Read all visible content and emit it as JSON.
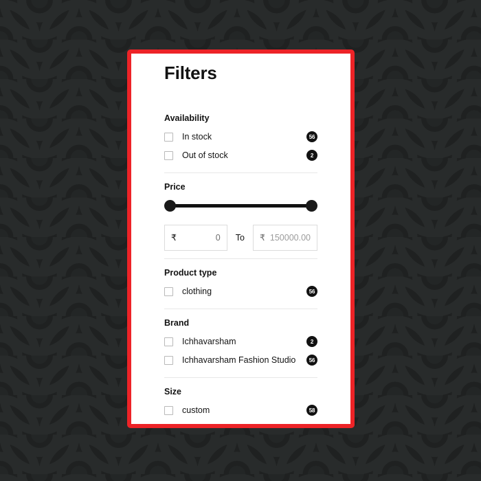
{
  "background": {
    "pattern_name": "seigaiha-wave-pattern",
    "base_color": "#1f2121",
    "arc_color": "#272a2a"
  },
  "panel": {
    "border_color": "#ed2327",
    "background_color": "#ffffff",
    "title": "Filters"
  },
  "sections": [
    {
      "name": "availability",
      "label": "Availability",
      "options": [
        {
          "label": "In stock",
          "count": "56"
        },
        {
          "label": "Out of stock",
          "count": "2"
        }
      ]
    },
    {
      "name": "price",
      "label": "Price",
      "slider": {
        "min_handle_name": "price-range-min-handle",
        "max_handle_name": "price-range-max-handle"
      },
      "from": {
        "currency_symbol": "₹",
        "value": "0",
        "placeholder": "0"
      },
      "separator_label": "To",
      "to": {
        "currency_symbol": "₹",
        "value": "",
        "placeholder": "150000.00"
      }
    },
    {
      "name": "product-type",
      "label": "Product type",
      "options": [
        {
          "label": "clothing",
          "count": "56"
        }
      ]
    },
    {
      "name": "brand",
      "label": "Brand",
      "options": [
        {
          "label": "Ichhavarsham",
          "count": "2"
        },
        {
          "label": "Ichhavarsham Fashion Studio",
          "count": "56"
        }
      ]
    },
    {
      "name": "size",
      "label": "Size",
      "options": [
        {
          "label": "custom",
          "count": "58"
        }
      ]
    }
  ]
}
